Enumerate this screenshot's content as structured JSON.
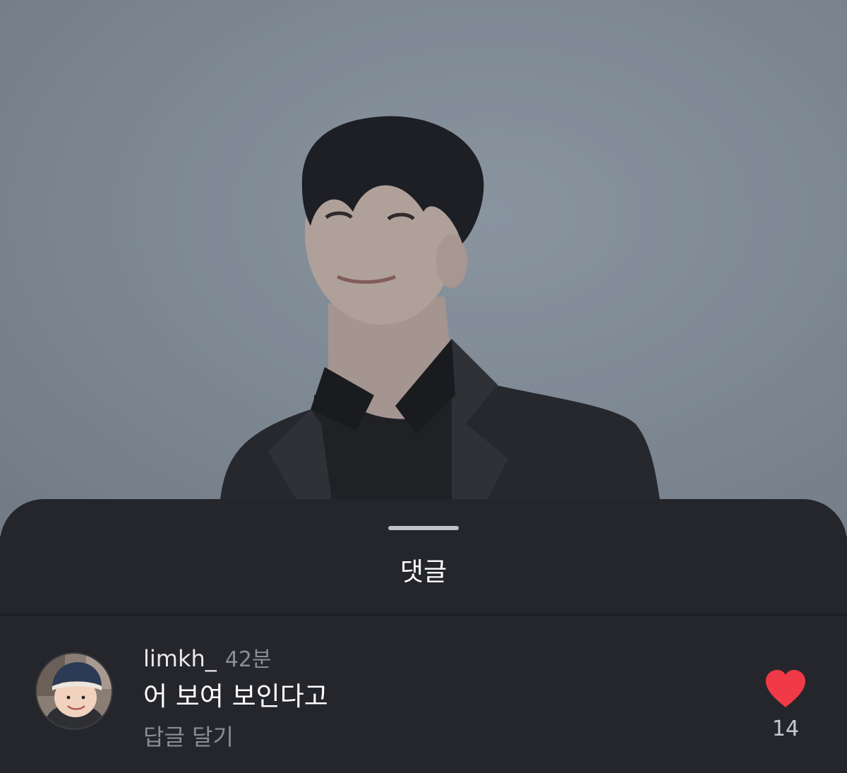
{
  "colors": {
    "sheet_background": "#25262b",
    "like_heart": "#f03a47",
    "muted_text": "#8b8d93"
  },
  "sheet": {
    "title": "댓글"
  },
  "comment": {
    "avatar_icon": "user-avatar-photo",
    "username": "limkh_",
    "time": "42분",
    "text": "어 보여 보인다고",
    "reply_label": "답글 달기",
    "like_icon": "heart-icon",
    "like_count": "14"
  }
}
